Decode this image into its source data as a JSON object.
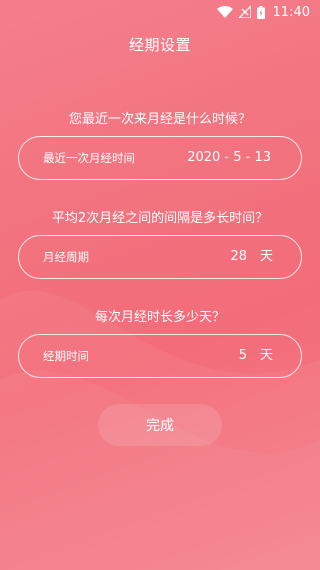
{
  "status_bar": {
    "time": "11:40",
    "icons": [
      "wifi-icon",
      "signal-icon",
      "battery-icon"
    ]
  },
  "header": {
    "title": "经期设置"
  },
  "questions": {
    "last_period": "您最近一次来月经是什么时候？",
    "cycle": "平均2次月经之间的间隔是多长时间？",
    "duration": "每次月经时长多少天？"
  },
  "fields": {
    "last_period": {
      "label": "最近一次月经时间",
      "value": "2020 - 5 - 13"
    },
    "cycle": {
      "label": "月经周期",
      "value": "28",
      "unit": "天"
    },
    "duration": {
      "label": "经期时间",
      "value": "5",
      "unit": "天"
    }
  },
  "actions": {
    "done_label": "完成"
  },
  "colors": {
    "background": "#f2737f",
    "text": "#ffffff"
  }
}
